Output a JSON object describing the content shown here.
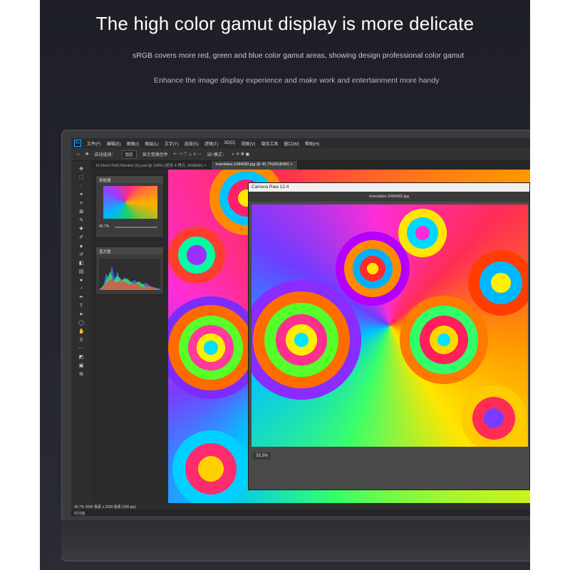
{
  "headline": "The high color gamut display is more delicate",
  "subtext_1": "sRGB covers more red, green and blue color gamut areas, showing design professional color gamut",
  "subtext_2": "Enhance the image display experience and make work and entertainment more handy",
  "photoshop": {
    "logo": "Ps",
    "menu": [
      "文件(F)",
      "编辑(E)",
      "图像(I)",
      "图层(L)",
      "文字(Y)",
      "选择(S)",
      "滤镜(T)",
      "3D(D)",
      "视图(V)",
      "增效工具",
      "窗口(W)",
      "帮助(H)"
    ],
    "options": {
      "auto_select": "自动选择：",
      "layer_select": "图层",
      "show_transform": "显示变换控件",
      "mode_3d": "3D 模式："
    },
    "tabs": [
      {
        "label": "15.6inch FHD Monitor (6).psd @ 100% (矩形 4 拷贝, RGB/8#) ×",
        "active": false
      },
      {
        "label": "mandalas-1084082.jpg @ 45.7%(RGB/8#) ×",
        "active": true
      }
    ],
    "navigator": {
      "title": "导航器",
      "zoom": "45.7%"
    },
    "histogram": {
      "title": "直方图"
    },
    "camera_raw": {
      "title": "Camera Raw 12.4",
      "filename": "mandalas-1084082.jpg",
      "zoom": "33.3%"
    },
    "status": "45.7%    3066 像素 x 2000 像素 (300 ppi)",
    "timeline": "时间轴"
  }
}
